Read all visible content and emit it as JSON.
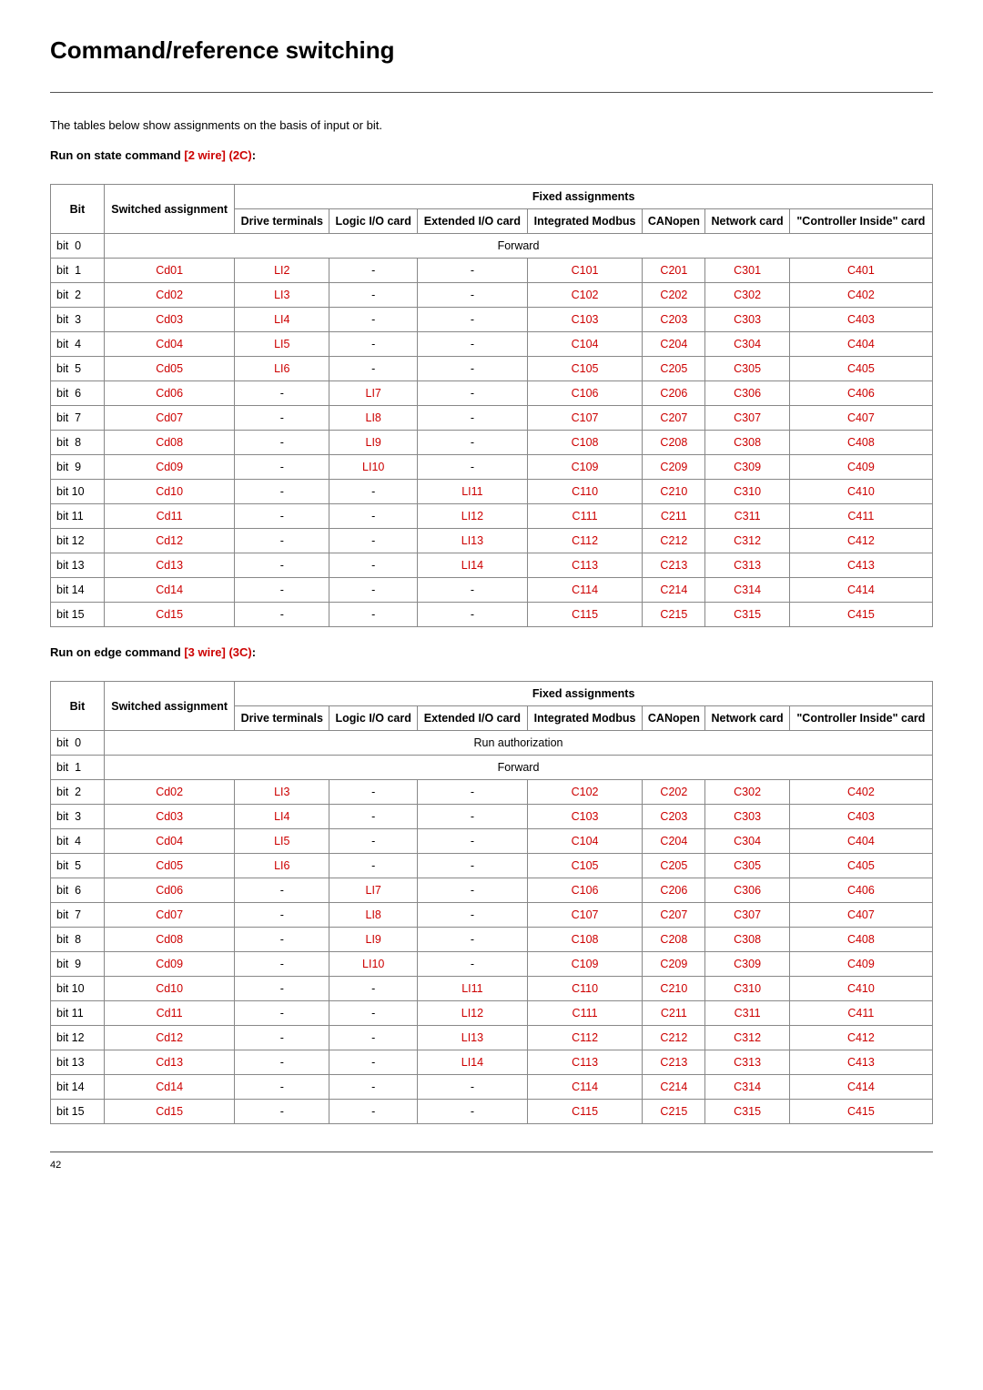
{
  "title": "Command/reference switching",
  "intro": "The tables below show assignments on the basis of input or bit.",
  "sub1_pre": "Run on state command ",
  "sub1_red": "[2 wire] (2C)",
  "sub1_post": ":",
  "sub2_pre": "Run on edge command ",
  "sub2_red": "[3 wire] (3C)",
  "sub2_post": ":",
  "headers": {
    "fixed": "Fixed assignments",
    "bit": "Bit",
    "switched": "Switched assignment",
    "drive": "Drive terminals",
    "logic": "Logic I/O card",
    "extio": "Extended I/O card",
    "modbus": "Integrated Modbus",
    "canopen": "CANopen",
    "network": "Network card",
    "controller": "\"Controller Inside\" card"
  },
  "forward": "Forward",
  "runauth": "Run authorization",
  "pageno": "42",
  "t1": {
    "rows": [
      {
        "bit": "bit  0",
        "span": "Forward"
      },
      {
        "bit": "bit  1",
        "sw": "Cd01",
        "d": "LI2",
        "l": "-",
        "e": "-",
        "m": "C101",
        "c": "C201",
        "n": "C301",
        "ci": "C401"
      },
      {
        "bit": "bit  2",
        "sw": "Cd02",
        "d": "LI3",
        "l": "-",
        "e": "-",
        "m": "C102",
        "c": "C202",
        "n": "C302",
        "ci": "C402"
      },
      {
        "bit": "bit  3",
        "sw": "Cd03",
        "d": "LI4",
        "l": "-",
        "e": "-",
        "m": "C103",
        "c": "C203",
        "n": "C303",
        "ci": "C403"
      },
      {
        "bit": "bit  4",
        "sw": "Cd04",
        "d": "LI5",
        "l": "-",
        "e": "-",
        "m": "C104",
        "c": "C204",
        "n": "C304",
        "ci": "C404"
      },
      {
        "bit": "bit  5",
        "sw": "Cd05",
        "d": "LI6",
        "l": "-",
        "e": "-",
        "m": "C105",
        "c": "C205",
        "n": "C305",
        "ci": "C405"
      },
      {
        "bit": "bit  6",
        "sw": "Cd06",
        "d": "-",
        "l": "LI7",
        "e": "-",
        "m": "C106",
        "c": "C206",
        "n": "C306",
        "ci": "C406"
      },
      {
        "bit": "bit  7",
        "sw": "Cd07",
        "d": "-",
        "l": "LI8",
        "e": "-",
        "m": "C107",
        "c": "C207",
        "n": "C307",
        "ci": "C407"
      },
      {
        "bit": "bit  8",
        "sw": "Cd08",
        "d": "-",
        "l": "LI9",
        "e": "-",
        "m": "C108",
        "c": "C208",
        "n": "C308",
        "ci": "C408"
      },
      {
        "bit": "bit  9",
        "sw": "Cd09",
        "d": "-",
        "l": "LI10",
        "e": "-",
        "m": "C109",
        "c": "C209",
        "n": "C309",
        "ci": "C409"
      },
      {
        "bit": "bit 10",
        "sw": "Cd10",
        "d": "-",
        "l": "-",
        "e": "LI11",
        "m": "C110",
        "c": "C210",
        "n": "C310",
        "ci": "C410"
      },
      {
        "bit": "bit 11",
        "sw": "Cd11",
        "d": "-",
        "l": "-",
        "e": "LI12",
        "m": "C111",
        "c": "C211",
        "n": "C311",
        "ci": "C411"
      },
      {
        "bit": "bit 12",
        "sw": "Cd12",
        "d": "-",
        "l": "-",
        "e": "LI13",
        "m": "C112",
        "c": "C212",
        "n": "C312",
        "ci": "C412"
      },
      {
        "bit": "bit 13",
        "sw": "Cd13",
        "d": "-",
        "l": "-",
        "e": "LI14",
        "m": "C113",
        "c": "C213",
        "n": "C313",
        "ci": "C413"
      },
      {
        "bit": "bit 14",
        "sw": "Cd14",
        "d": "-",
        "l": "-",
        "e": "-",
        "m": "C114",
        "c": "C214",
        "n": "C314",
        "ci": "C414"
      },
      {
        "bit": "bit 15",
        "sw": "Cd15",
        "d": "-",
        "l": "-",
        "e": "-",
        "m": "C115",
        "c": "C215",
        "n": "C315",
        "ci": "C415"
      }
    ]
  },
  "t2": {
    "rows": [
      {
        "bit": "bit  0",
        "span": "Run authorization"
      },
      {
        "bit": "bit  1",
        "span": "Forward"
      },
      {
        "bit": "bit  2",
        "sw": "Cd02",
        "d": "LI3",
        "l": "-",
        "e": "-",
        "m": "C102",
        "c": "C202",
        "n": "C302",
        "ci": "C402"
      },
      {
        "bit": "bit  3",
        "sw": "Cd03",
        "d": "LI4",
        "l": "-",
        "e": "-",
        "m": "C103",
        "c": "C203",
        "n": "C303",
        "ci": "C403"
      },
      {
        "bit": "bit  4",
        "sw": "Cd04",
        "d": "LI5",
        "l": "-",
        "e": "-",
        "m": "C104",
        "c": "C204",
        "n": "C304",
        "ci": "C404"
      },
      {
        "bit": "bit  5",
        "sw": "Cd05",
        "d": "LI6",
        "l": "-",
        "e": "-",
        "m": "C105",
        "c": "C205",
        "n": "C305",
        "ci": "C405"
      },
      {
        "bit": "bit  6",
        "sw": "Cd06",
        "d": "-",
        "l": "LI7",
        "e": "-",
        "m": "C106",
        "c": "C206",
        "n": "C306",
        "ci": "C406"
      },
      {
        "bit": "bit  7",
        "sw": "Cd07",
        "d": "-",
        "l": "LI8",
        "e": "-",
        "m": "C107",
        "c": "C207",
        "n": "C307",
        "ci": "C407"
      },
      {
        "bit": "bit  8",
        "sw": "Cd08",
        "d": "-",
        "l": "LI9",
        "e": "-",
        "m": "C108",
        "c": "C208",
        "n": "C308",
        "ci": "C408"
      },
      {
        "bit": "bit  9",
        "sw": "Cd09",
        "d": "-",
        "l": "LI10",
        "e": "-",
        "m": "C109",
        "c": "C209",
        "n": "C309",
        "ci": "C409"
      },
      {
        "bit": "bit 10",
        "sw": "Cd10",
        "d": "-",
        "l": "-",
        "e": "LI11",
        "m": "C110",
        "c": "C210",
        "n": "C310",
        "ci": "C410"
      },
      {
        "bit": "bit 11",
        "sw": "Cd11",
        "d": "-",
        "l": "-",
        "e": "LI12",
        "m": "C111",
        "c": "C211",
        "n": "C311",
        "ci": "C411"
      },
      {
        "bit": "bit 12",
        "sw": "Cd12",
        "d": "-",
        "l": "-",
        "e": "LI13",
        "m": "C112",
        "c": "C212",
        "n": "C312",
        "ci": "C412"
      },
      {
        "bit": "bit 13",
        "sw": "Cd13",
        "d": "-",
        "l": "-",
        "e": "LI14",
        "m": "C113",
        "c": "C213",
        "n": "C313",
        "ci": "C413"
      },
      {
        "bit": "bit 14",
        "sw": "Cd14",
        "d": "-",
        "l": "-",
        "e": "-",
        "m": "C114",
        "c": "C214",
        "n": "C314",
        "ci": "C414"
      },
      {
        "bit": "bit 15",
        "sw": "Cd15",
        "d": "-",
        "l": "-",
        "e": "-",
        "m": "C115",
        "c": "C215",
        "n": "C315",
        "ci": "C415"
      }
    ]
  }
}
